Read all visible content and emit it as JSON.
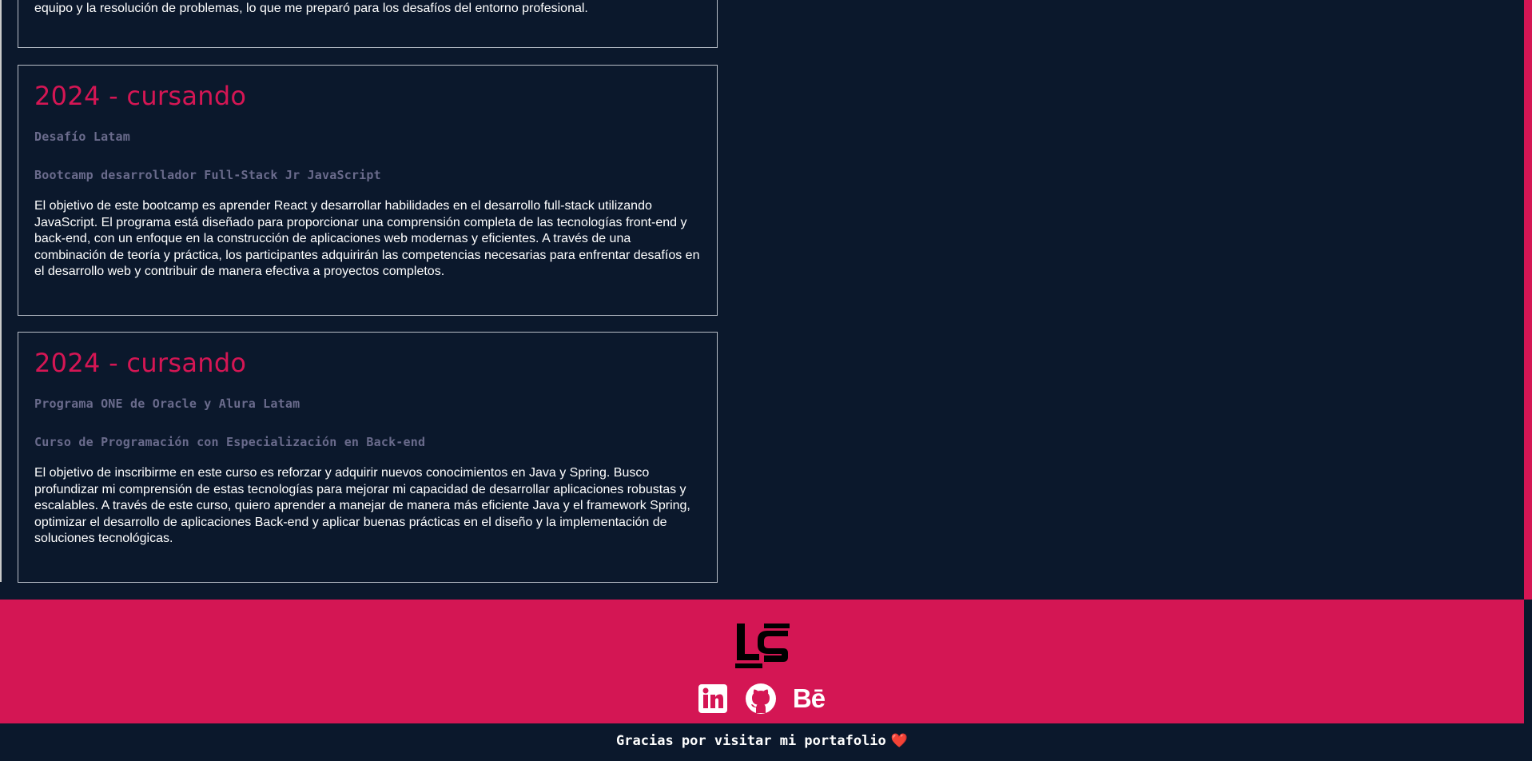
{
  "cards": [
    {
      "text": "equipo y la resolución de problemas, lo que me preparó para los desafíos del entorno profesional."
    },
    {
      "year": "2024 - cursando",
      "institution": "Desafío Latam",
      "course": "Bootcamp desarrollador Full-Stack Jr JavaScript",
      "description": "El objetivo de este bootcamp es aprender React y desarrollar habilidades en el desarrollo full-stack utilizando JavaScript. El programa está diseñado para proporcionar una comprensión completa de las tecnologías front-end y back-end, con un enfoque en la construcción de aplicaciones web modernas y eficientes. A través de una combinación de teoría y práctica, los participantes adquirirán las competencias necesarias para enfrentar desafíos en el desarrollo web y contribuir de manera efectiva a proyectos completos."
    },
    {
      "year": "2024 - cursando",
      "institution": "Programa ONE de Oracle y Alura Latam",
      "course": "Curso de Programación con Especialización en Back-end",
      "description": "El objetivo de inscribirme en este curso es reforzar y adquirir nuevos conocimientos en Java y Spring. Busco profundizar mi comprensión de estas tecnologías para mejorar mi capacidad de desarrollar aplicaciones robustas y escalables. A través de este curso, quiero aprender a manejar de manera más eficiente Java y el framework Spring, optimizar el desarrollo de aplicaciones Back-end y aplicar buenas prácticas en el diseño y la implementación de soluciones tecnológicas."
    }
  ],
  "footer": {
    "logo_letters": "LS",
    "social": [
      {
        "name": "linkedin-icon"
      },
      {
        "name": "github-icon"
      },
      {
        "name": "behance-icon",
        "text": "Bē"
      }
    ],
    "thanks": "Gracias por visitar mi portafolio",
    "heart": "❤️"
  },
  "colors": {
    "background": "#0b182c",
    "accent": "#d41654",
    "muted": "#6a6b8c",
    "border": "#b8bec8"
  }
}
